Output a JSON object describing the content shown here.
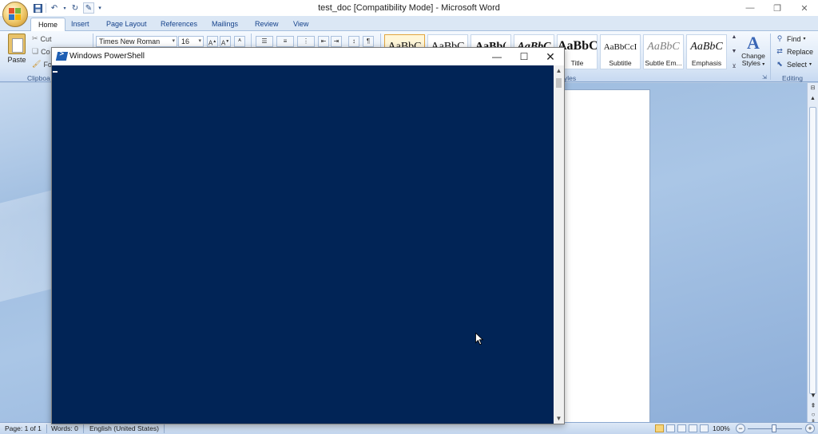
{
  "word": {
    "window_title": "test_doc [Compatibility Mode] - Microsoft Word",
    "tabs": [
      {
        "label": "Home"
      },
      {
        "label": "Insert"
      },
      {
        "label": "Page Layout"
      },
      {
        "label": "References"
      },
      {
        "label": "Mailings"
      },
      {
        "label": "Review"
      },
      {
        "label": "View"
      }
    ],
    "clipboard": {
      "paste_label": "Paste",
      "cut_label": "Cut",
      "copy_label": "Co",
      "format_label": "Fo",
      "group_label": "Clipboa"
    },
    "font": {
      "name": "Times New Roman",
      "size": "16"
    },
    "styles": {
      "tiles": [
        {
          "preview": "AaBbC",
          "name": ""
        },
        {
          "preview": "AaBbC",
          "name": ""
        },
        {
          "preview": "AaBb(",
          "name": ""
        },
        {
          "preview": "AaBbC",
          "name": ""
        },
        {
          "preview": "AaBbC",
          "name": "Title"
        },
        {
          "preview": "AaBbCcI",
          "name": "Subtitle"
        },
        {
          "preview": "AaBbC",
          "name": "Subtle Em..."
        },
        {
          "preview": "AaBbC",
          "name": "Emphasis"
        }
      ],
      "change_styles_label_1": "Change",
      "change_styles_label_2": "Styles",
      "group_label": "yles"
    },
    "editing": {
      "find_label": "Find",
      "replace_label": "Replace",
      "select_label": "Select",
      "group_label": "Editing"
    },
    "status": {
      "page": "Page: 1 of 1",
      "words": "Words: 0",
      "language": "English (United States)",
      "zoom": "100%"
    }
  },
  "powershell": {
    "title": "Windows PowerShell"
  },
  "colors": {
    "console_bg": "#012456",
    "ribbon_blue": "#15428b"
  }
}
